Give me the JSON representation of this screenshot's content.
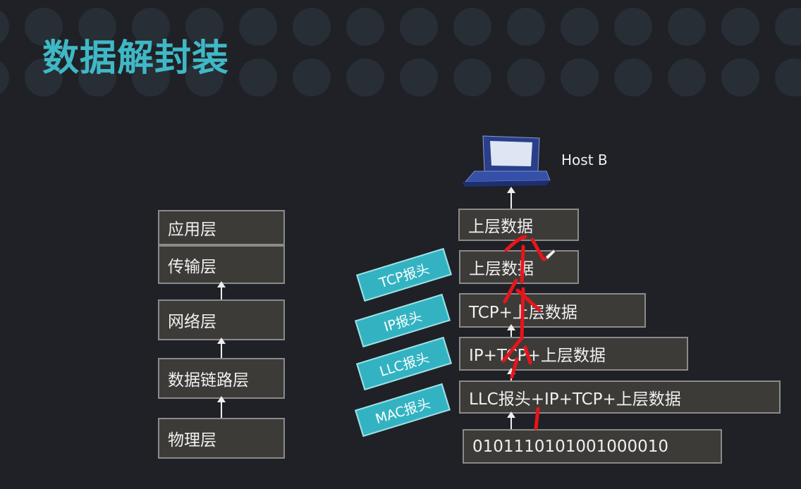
{
  "title": "数据解封装",
  "host_label": "Host B",
  "osi_layers": [
    "应用层",
    "传输层",
    "网络层",
    "数据链路层",
    "物理层"
  ],
  "decap_stack": [
    "上层数据",
    "上层数据",
    "TCP+上层数据",
    "IP+TCP+上层数据",
    "LLC报头+IP+TCP+上层数据",
    "010111010100100001​0"
  ],
  "headers": [
    "TCP报头",
    "IP报头",
    "LLC报头",
    "MAC报头"
  ],
  "colors": {
    "background": "#1f2126",
    "accent": "#3fb8c6",
    "ink": "#e8141b"
  }
}
